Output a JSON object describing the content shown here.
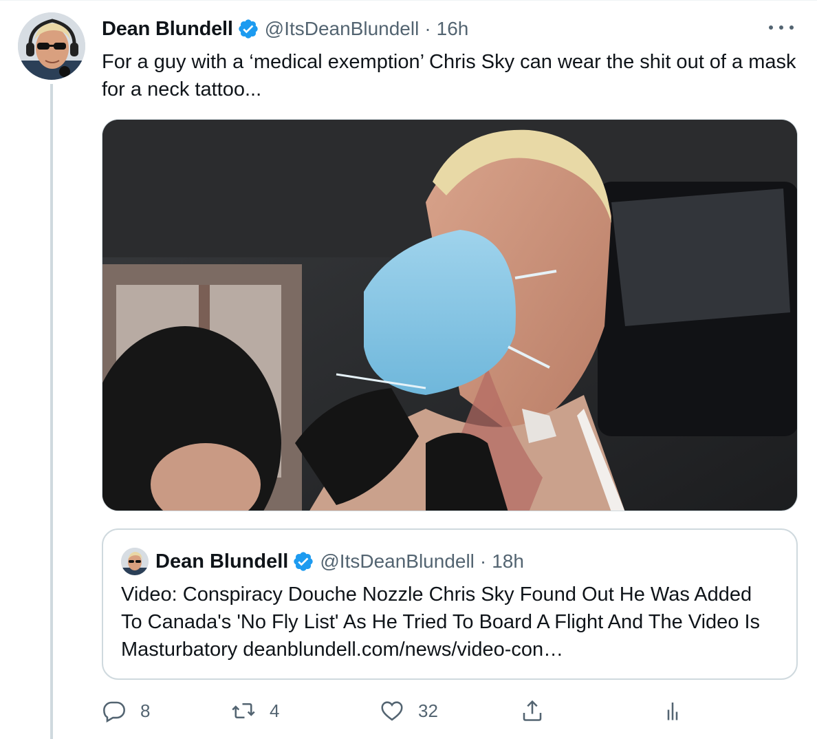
{
  "tweet": {
    "author": {
      "display_name": "Dean Blundell",
      "handle": "@ItsDeanBlundell",
      "verified": true
    },
    "separator": "·",
    "time": "16h",
    "text": "For a guy with a ‘medical exemption’ Chris Sky can wear the shit out of a mask for a neck tattoo...",
    "more_icon": "more-horizontal-icon"
  },
  "quote": {
    "author": {
      "display_name": "Dean Blundell",
      "handle": "@ItsDeanBlundell",
      "verified": true
    },
    "separator": "·",
    "time": "18h",
    "text": "Video: Conspiracy Douche Nozzle Chris Sky Found Out He Was Added To Canada's 'No Fly List' As He Tried To Board A Flight And The Video Is Masturbatory deanblundell.com/news/video-con…"
  },
  "actions": {
    "reply": {
      "icon": "reply-icon",
      "count": "8"
    },
    "retweet": {
      "icon": "retweet-icon",
      "count": "4"
    },
    "like": {
      "icon": "heart-icon",
      "count": "32"
    },
    "share": {
      "icon": "share-icon"
    },
    "analytics": {
      "icon": "analytics-icon"
    }
  },
  "colors": {
    "verified_blue": "#1d9bf0",
    "secondary_text": "#536471",
    "border": "#cfd9de"
  }
}
